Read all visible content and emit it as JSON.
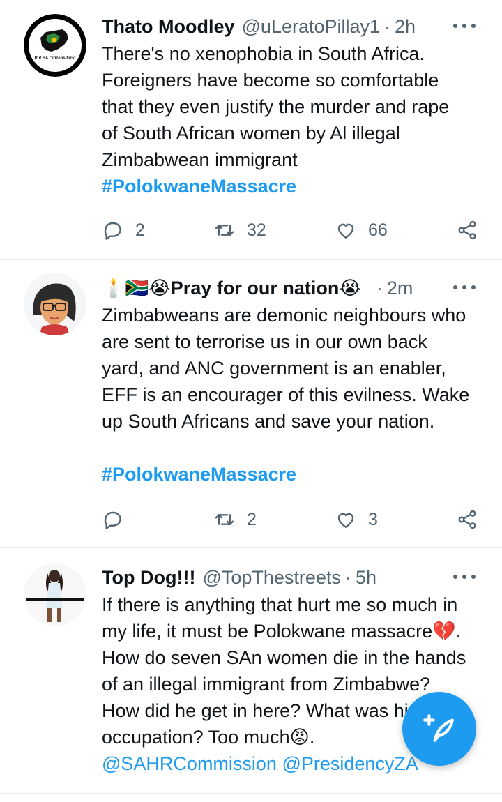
{
  "tweets": [
    {
      "name": "Thato Moodley",
      "handle": "@uLeratoPillay1",
      "separator": "·",
      "time": "2h",
      "text_lines": [
        "There's no xenophobia in South Africa.",
        "Foreigners have become so comfortable",
        "that they even justify the murder and rape",
        "of South African women by Al illegal",
        "Zimbabwean immigrant"
      ],
      "hashtag": "#PolokwaneMassacre",
      "avatar_text": "Put SA Citizens First",
      "replies": "2",
      "retweets": "32",
      "likes": "66"
    },
    {
      "name_emoji_prefix": "🕯️🇿🇦😭",
      "name": "Pray for our nation",
      "name_emoji_suffix": "😭",
      "separator": "·",
      "time": "2m",
      "text_lines": [
        "Zimbabweans are demonic neighbours who",
        "are sent to terrorise us in our own back",
        "yard, and ANC government is an enabler,",
        "EFF is an encourager of this evilness. Wake",
        "up South Africans and save your nation."
      ],
      "hashtag": "#PolokwaneMassacre",
      "replies": "",
      "retweets": "2",
      "likes": "3"
    },
    {
      "name": "Top Dog!!!",
      "handle": "@TopThestreets",
      "separator": "·",
      "time": "5h",
      "text_lines": [
        "If there is anything that hurt me so much in",
        "my life, it must be Polokwane massacre💔.",
        "How do seven SAn women die in the hands",
        "of an illegal immigrant from Zimbabwe?",
        "How did he get in here? What was his",
        "occupation? Too much😡."
      ],
      "mentions": "@SAHRCommission @PresidencyZA"
    }
  ],
  "colors": {
    "accent": "#1d9bf0",
    "secondary_text": "#536471",
    "divider": "#e6ecf0"
  },
  "icons": [
    "reply-icon",
    "retweet-icon",
    "like-icon",
    "share-icon",
    "more-icon",
    "compose-icon"
  ]
}
